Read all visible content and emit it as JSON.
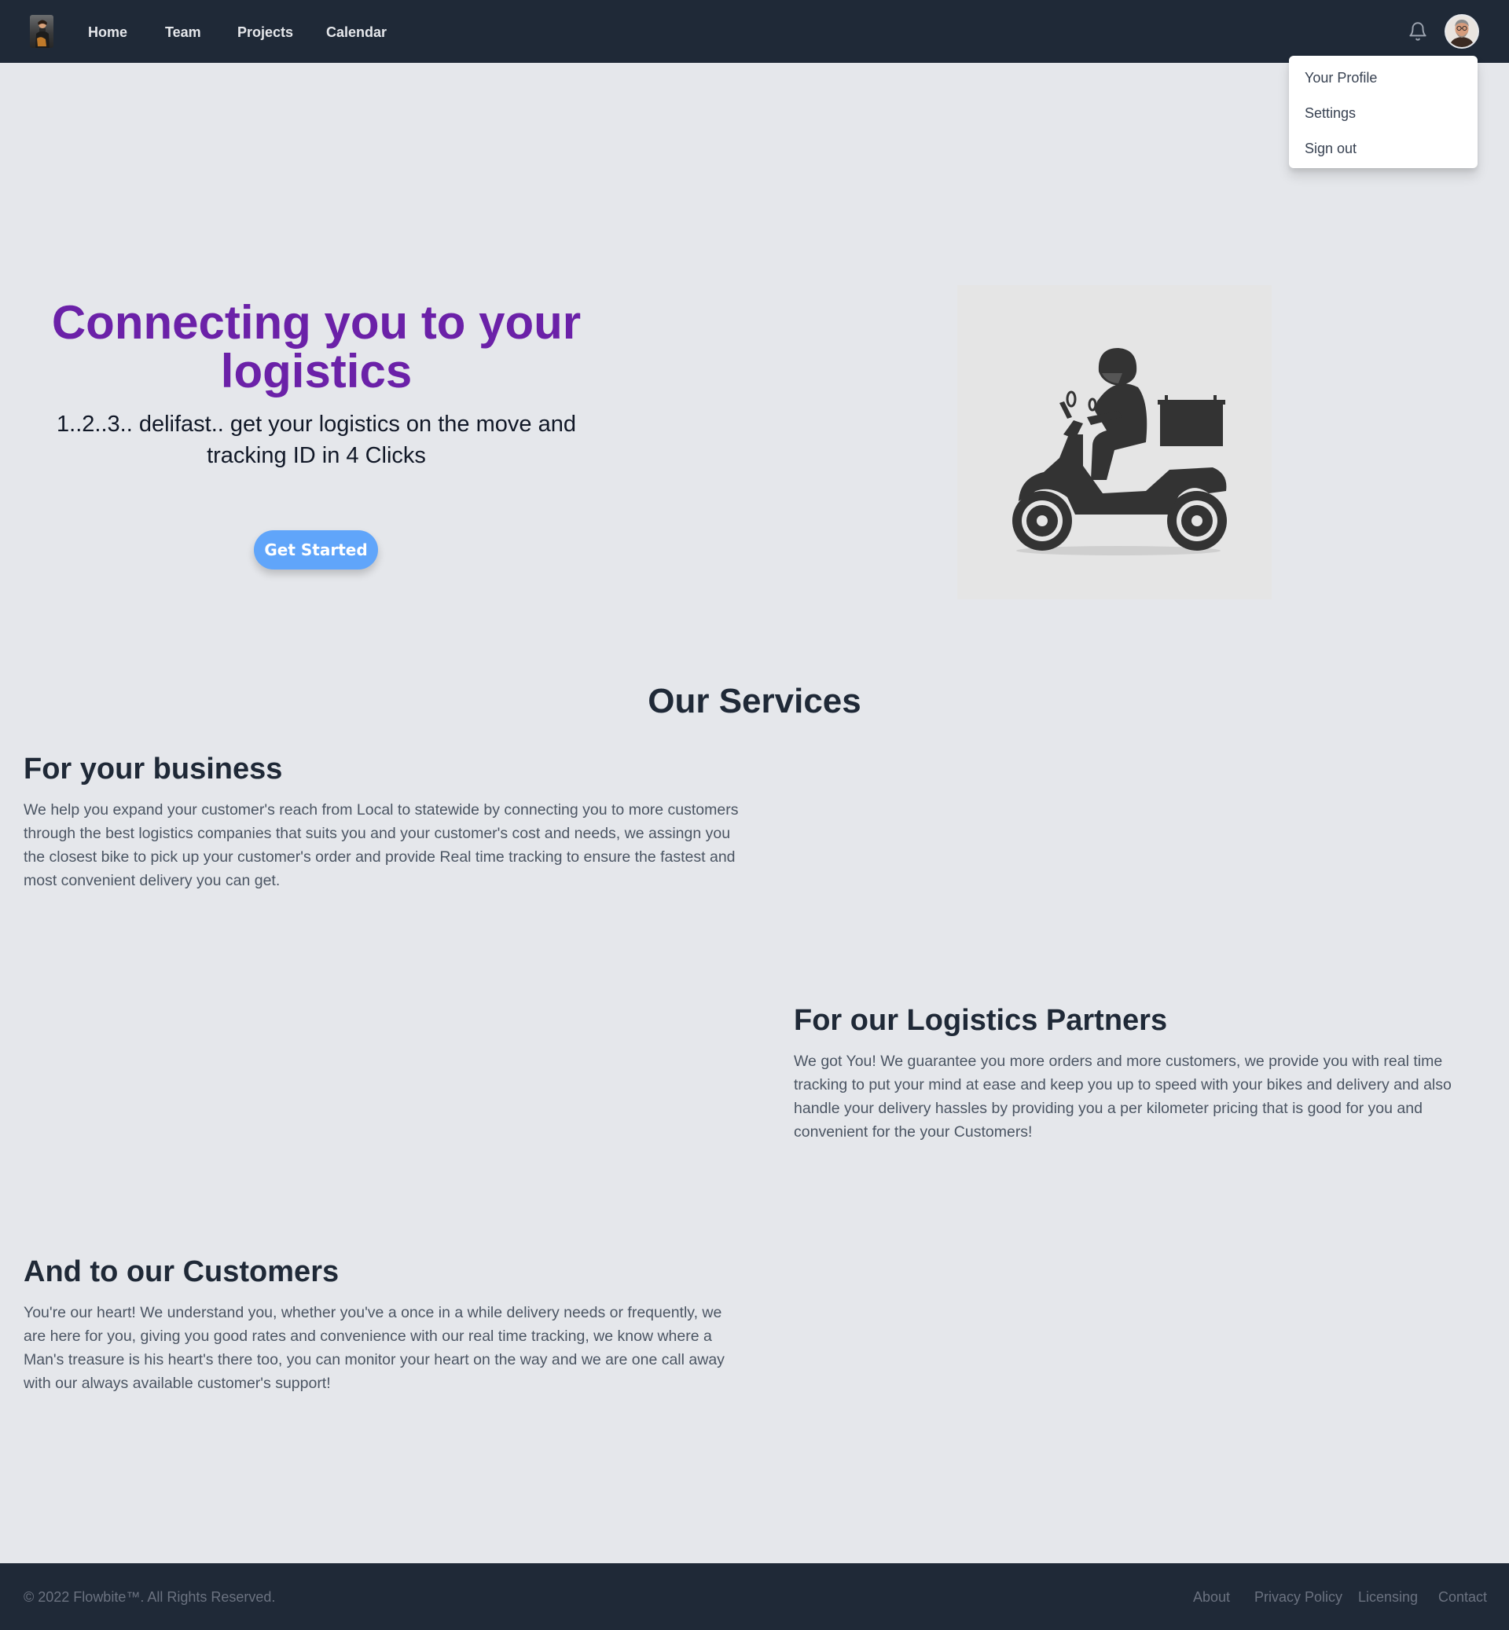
{
  "nav": {
    "links": [
      "Home",
      "Team",
      "Projects",
      "Calendar"
    ]
  },
  "user_menu": {
    "items": [
      "Your Profile",
      "Settings",
      "Sign out"
    ]
  },
  "hero": {
    "title": "Connecting you to your logistics",
    "subtitle": "1..2..3.. delifast.. get your logistics on the move and tracking ID in 4 Clicks",
    "cta_label": "Get Started",
    "image_icon": "scooter-delivery-icon"
  },
  "services": {
    "title": "Our Services",
    "items": [
      {
        "heading": "For your business",
        "text": "We help you expand your customer's reach from Local to statewide by connecting you to more customers through the best logistics companies that suits you and your customer's cost and needs, we assingn you the closest bike to pick up your customer's order and provide Real time tracking to ensure the fastest and most convenient delivery you can get."
      },
      {
        "heading": "For our Logistics Partners",
        "text": "We got You! We guarantee you more orders and more customers, we provide you with real time tracking to put your mind at ease and keep you up to speed with your bikes and delivery and also handle your delivery hassles by providing you a per kilometer pricing that is good for you and convenient for the your Customers!"
      },
      {
        "heading": "And to our Customers",
        "text": "You're our heart! We understand you, whether you've a once in a while delivery needs or frequently, we are here for you, giving you good rates and convenience with our real time tracking, we know where a Man's treasure is his heart's there too, you can monitor your heart on the way and we are one call away with our always available customer's support!"
      }
    ]
  },
  "footer": {
    "copyright": "© 2022 Flowbite™. All Rights Reserved.",
    "links": [
      "About",
      "Privacy Policy",
      "Licensing",
      "Contact"
    ]
  },
  "colors": {
    "nav_bg": "#1f2937",
    "page_bg": "#e5e7eb",
    "hero_title": "#6b21a8",
    "cta_bg": "#60a5fa"
  }
}
